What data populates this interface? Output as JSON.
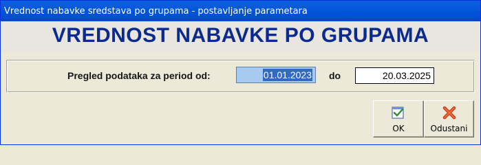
{
  "window": {
    "title": "Vrednost nabavke sredstava po grupama - postavljanje parametara"
  },
  "header": {
    "title": "VREDNOST NABAVKE PO GRUPAMA"
  },
  "period": {
    "label": "Pregled podataka za period od:",
    "from_value": "01.01.2023",
    "to_label": "do",
    "to_value": "20.03.2025"
  },
  "buttons": {
    "ok_label": "OK",
    "ok_icon": "checkmark-icon",
    "cancel_label": "Odustani",
    "cancel_icon": "red-x-icon"
  },
  "colors": {
    "title_color": "#0a2a8f",
    "titlebar_blue": "#0053d8",
    "selection": "#316ac5"
  }
}
